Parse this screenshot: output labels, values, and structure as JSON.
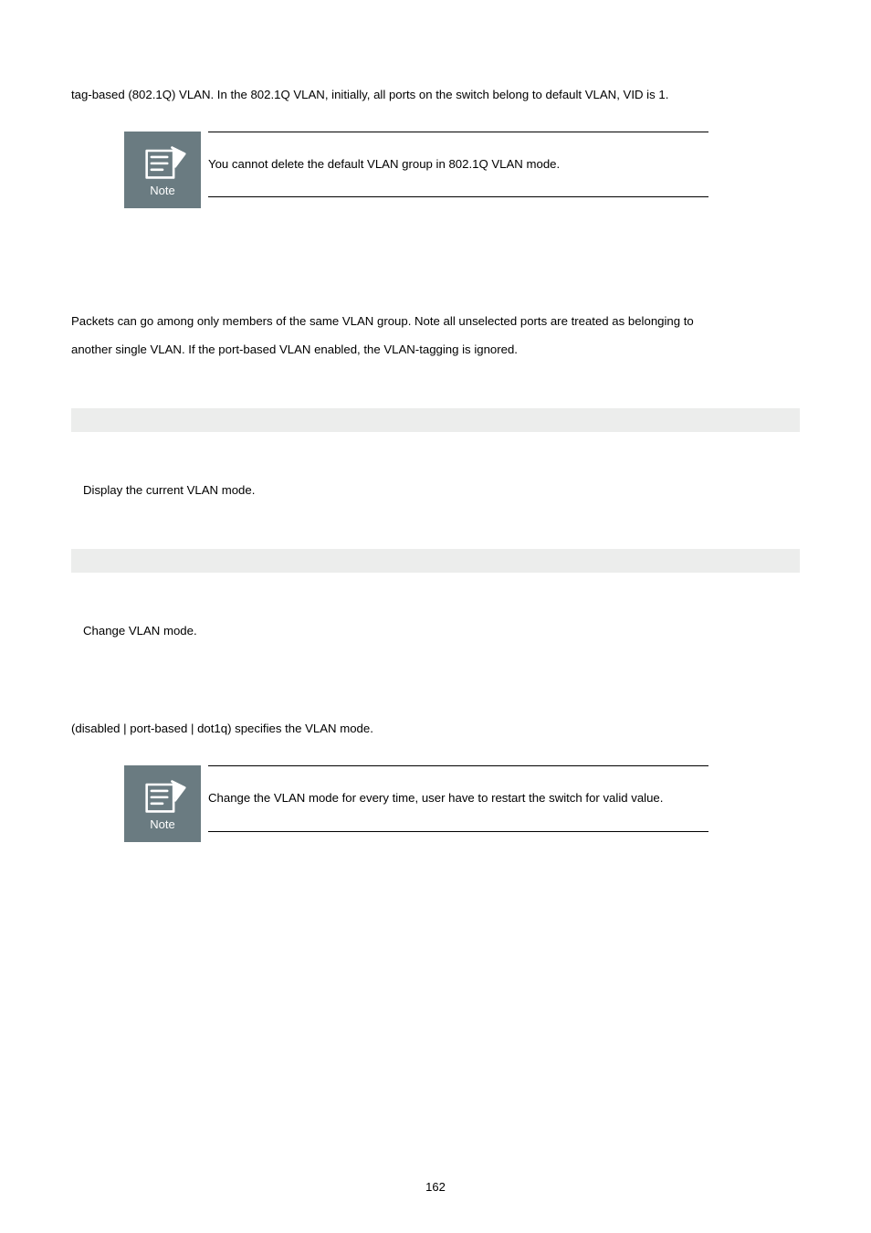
{
  "intro_line": "tag-based (802.1Q) VLAN. In the 802.1Q VLAN, initially, all ports on the switch belong to default VLAN, VID is 1.",
  "note1": {
    "label": "Note",
    "text": "You cannot delete the default VLAN group in 802.1Q VLAN mode."
  },
  "para_packets_1": "Packets can go among only members of the same VLAN group. Note all unselected ports are treated as belonging to",
  "para_packets_2": "another single VLAN. If the port-based VLAN enabled, the VLAN-tagging is ignored.",
  "display_mode": "Display the current VLAN mode.",
  "change_mode": "Change VLAN mode.",
  "specifies": "(disabled | port-based | dot1q) specifies the VLAN mode.",
  "note2": {
    "label": "Note",
    "text": "Change the VLAN mode for every time, user have to restart the switch for valid value."
  },
  "page_number": "162"
}
